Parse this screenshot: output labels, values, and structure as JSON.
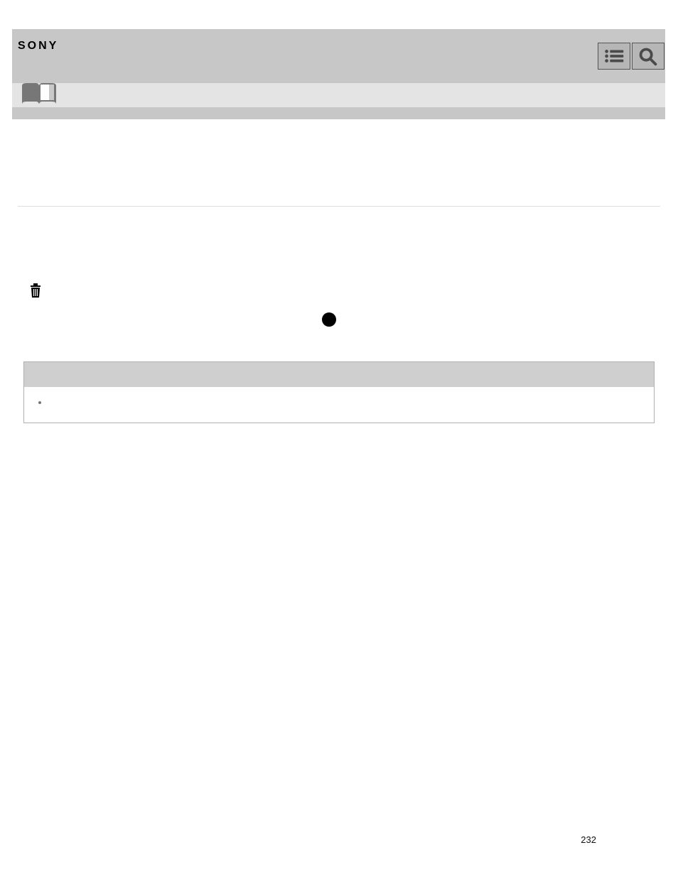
{
  "brand": "SONY",
  "page_number": "232",
  "icons": {
    "menu": "menu-list-icon",
    "search": "search-icon",
    "manual": "book-icon",
    "trash": "trash-icon",
    "dot": "record-dot-icon"
  },
  "notebox": {
    "bullet": ""
  }
}
